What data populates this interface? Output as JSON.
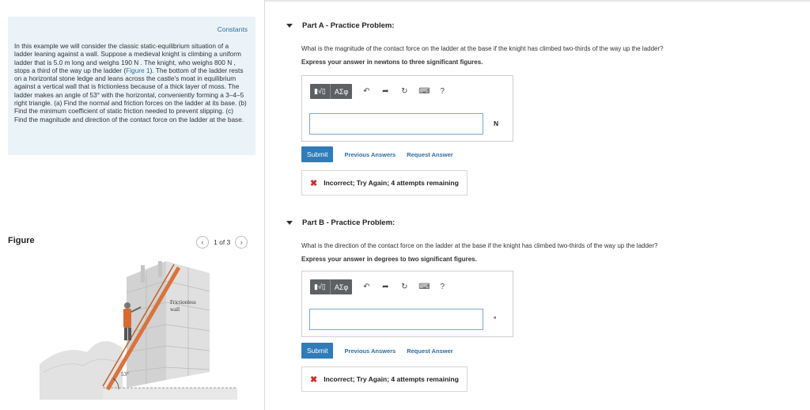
{
  "left": {
    "constants_link": "Constants",
    "problem_text_1": "In this example we will consider the classic static-equilibrium situation of a ladder leaning against a wall. Suppose a medieval knight is climbing a uniform ladder that is 5.0 m long and weighs 190 N . The knight, who weighs 800 N , stops a third of the way up the ladder (",
    "problem_link": "Figure 1",
    "problem_text_2": "). The bottom of the ladder rests on a horizontal stone ledge and leans across the castle's moat in equilibrium against a vertical wall that is frictionless because of a thick layer of moss. The ladder makes an angle of 53° with the horizontal, conveniently forming a 3–4–5 right triangle. (a) Find the normal and friction forces on the ladder at its base. (b) Find the minimum coefficient of static friction needed to prevent slipping. (c) Find the magnitude and direction of the contact force on the ladder at the base.",
    "figure_label": "Figure",
    "pager_text": "1 of 3",
    "figure_wall_label_1": "Frictionless",
    "figure_wall_label_2": "wall",
    "figure_angle": "53°"
  },
  "parts": [
    {
      "title": "Part A - Practice Problem:",
      "question": "What is the magnitude of the contact force on the ladder at the base if the knight has climbed two-thirds of the way up the ladder?",
      "instruction": "Express your answer in newtons to three significant figures.",
      "unit": "N",
      "submit": "Submit",
      "previous": "Previous Answers",
      "request": "Request Answer",
      "feedback": "Incorrect; Try Again; 4 attempts remaining"
    },
    {
      "title": "Part B - Practice Problem:",
      "question": "What is the direction of the contact force on the ladder at the base if the knight has climbed two-thirds of the way up the ladder?",
      "instruction": "Express your answer in degrees to two significant figures.",
      "unit": "°",
      "submit": "Submit",
      "previous": "Previous Answers",
      "request": "Request Answer",
      "feedback": "Incorrect; Try Again; 4 attempts remaining"
    }
  ],
  "toolbar": {
    "templates_label": "▮√▯",
    "symbols_label": "ΑΣφ",
    "undo_icon": "undo-icon",
    "redo_icon": "redo-icon",
    "reset_icon": "reset-icon",
    "keyboard_icon": "keyboard-icon",
    "help_label": "?"
  },
  "colors": {
    "accent": "#2f7cb8",
    "link": "#2c6d9e",
    "error": "#c9302c",
    "panel": "#eaf3f8"
  }
}
